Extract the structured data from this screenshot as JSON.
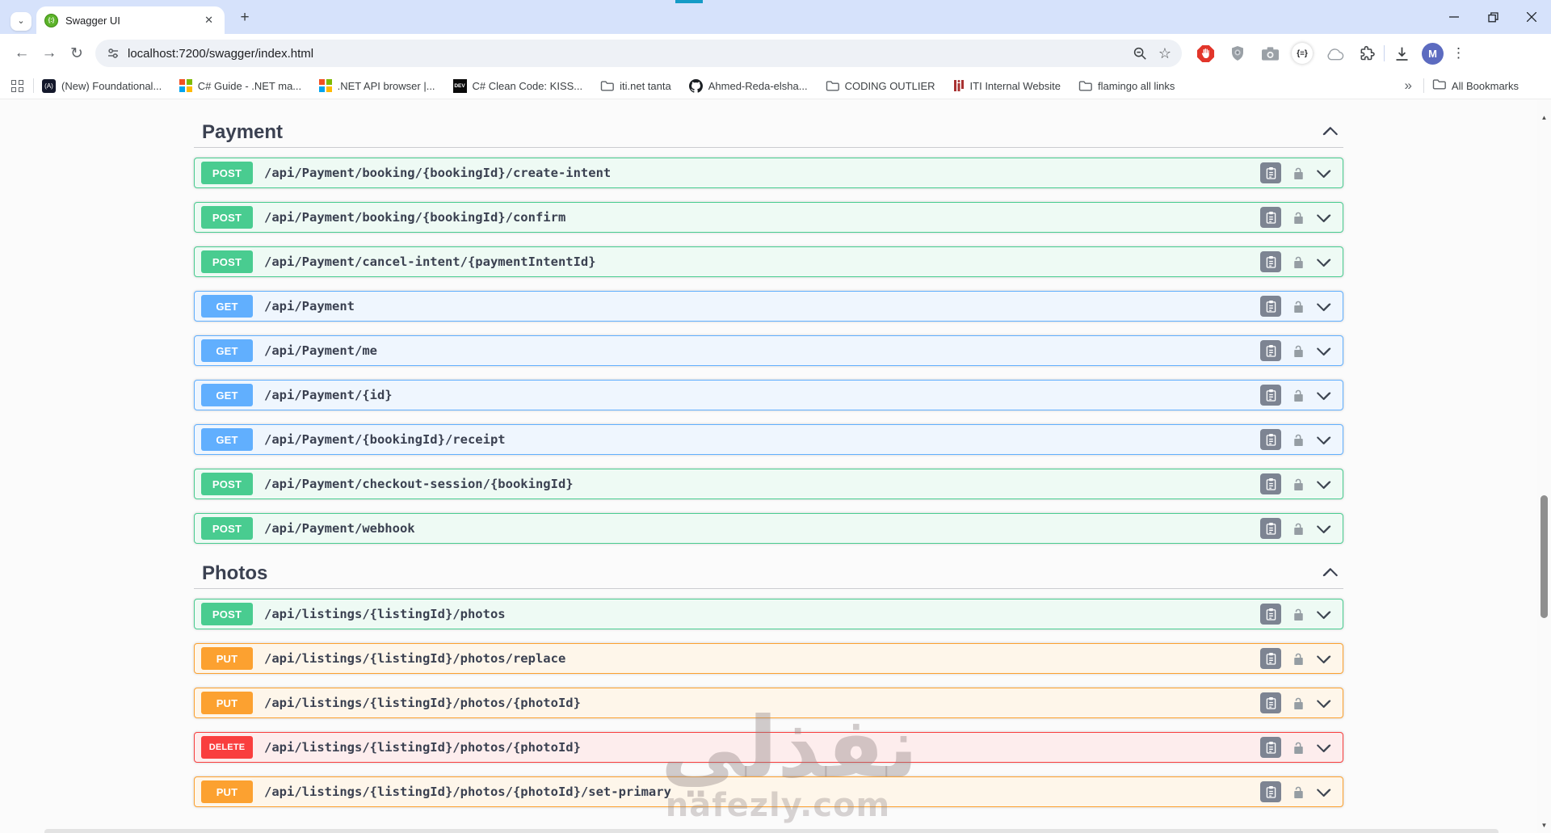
{
  "window": {
    "tab": {
      "title": "Swagger UI",
      "favicon_glyph": "{:}"
    },
    "new_tab_label": "+",
    "tab_search_glyph": "⌄",
    "tab_close_glyph": "✕",
    "accent_strip_color": "#149bc6",
    "titlebar_color": "#d6e2fb"
  },
  "toolbar": {
    "back_glyph": "←",
    "forward_glyph": "→",
    "reload_glyph": "↻",
    "url": "localhost:7200/swagger/index.html",
    "star_glyph": "☆",
    "json_ext_glyph": "{≡}",
    "avatar_letter": "M",
    "avatar_color": "#5c6bc0",
    "menu_glyph": "⋮"
  },
  "bookmarks_bar": {
    "items": [
      {
        "label": "(New) Foundational...",
        "icon": "dark-a"
      },
      {
        "label": "C# Guide - .NET ma...",
        "icon": "ms"
      },
      {
        "label": ".NET API browser |...",
        "icon": "ms"
      },
      {
        "label": "C# Clean Code: KISS...",
        "icon": "dev"
      },
      {
        "label": "iti.net tanta",
        "icon": "folder"
      },
      {
        "label": "Ahmed-Reda-elsha...",
        "icon": "github"
      },
      {
        "label": "CODING OUTLIER",
        "icon": "folder"
      },
      {
        "label": "ITI Internal Website",
        "icon": "iti"
      },
      {
        "label": "flamingo all links",
        "icon": "folder"
      }
    ],
    "overflow_glyph": "»",
    "all_bookmarks": {
      "label": "All Bookmarks",
      "icon": "folder"
    }
  },
  "swagger": {
    "methods": {
      "POST": {
        "badge": "#49cc90",
        "border": "#49cc90",
        "bg": "#eefaf4"
      },
      "GET": {
        "badge": "#61affe",
        "border": "#61affe",
        "bg": "#eff6fe"
      },
      "PUT": {
        "badge": "#fca130",
        "border": "#fca130",
        "bg": "#fef6ea"
      },
      "DELETE": {
        "badge": "#f93e3e",
        "border": "#f93e3e",
        "bg": "#fdeded"
      }
    },
    "sections": [
      {
        "title": "Payment",
        "expanded": true,
        "operations": [
          {
            "method": "POST",
            "path": "/api/Payment/booking/{bookingId}/create-intent"
          },
          {
            "method": "POST",
            "path": "/api/Payment/booking/{bookingId}/confirm"
          },
          {
            "method": "POST",
            "path": "/api/Payment/cancel-intent/{paymentIntentId}"
          },
          {
            "method": "GET",
            "path": "/api/Payment"
          },
          {
            "method": "GET",
            "path": "/api/Payment/me"
          },
          {
            "method": "GET",
            "path": "/api/Payment/{id}"
          },
          {
            "method": "GET",
            "path": "/api/Payment/{bookingId}/receipt"
          },
          {
            "method": "POST",
            "path": "/api/Payment/checkout-session/{bookingId}"
          },
          {
            "method": "POST",
            "path": "/api/Payment/webhook",
            "has_clipboard_icon": true
          }
        ]
      },
      {
        "title": "Photos",
        "expanded": true,
        "operations": [
          {
            "method": "POST",
            "path": "/api/listings/{listingId}/photos"
          },
          {
            "method": "PUT",
            "path": "/api/listings/{listingId}/photos/replace"
          },
          {
            "method": "PUT",
            "path": "/api/listings/{listingId}/photos/{photoId}"
          },
          {
            "method": "DELETE",
            "path": "/api/listings/{listingId}/photos/{photoId}"
          },
          {
            "method": "PUT",
            "path": "/api/listings/{listingId}/photos/{photoId}/set-primary"
          }
        ]
      }
    ]
  },
  "watermark": {
    "arabic": "نفذلي",
    "latin": "nafezly.com"
  },
  "scrollbar": {
    "up_glyph": "▲",
    "down_glyph": "▼"
  }
}
